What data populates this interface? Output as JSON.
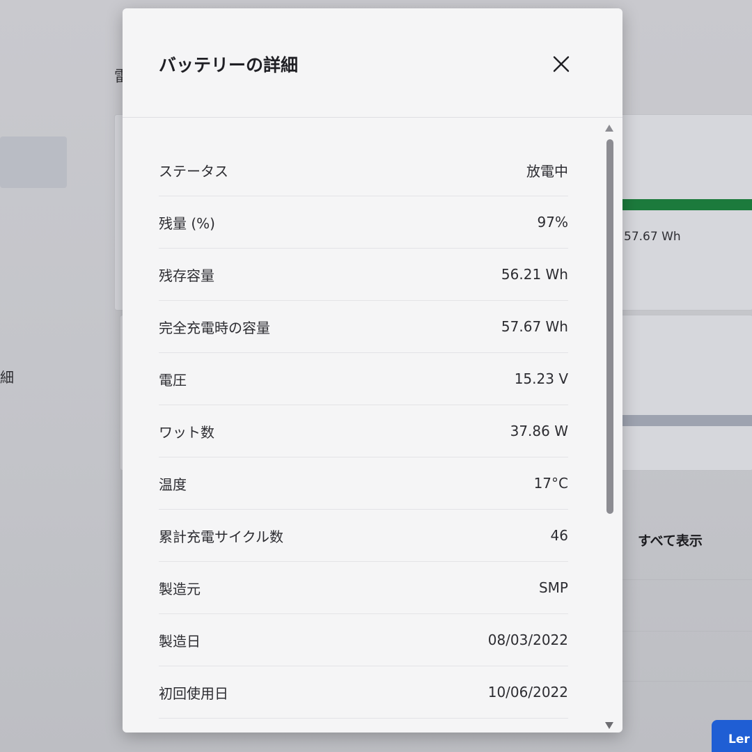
{
  "background": {
    "title_fragment": "雷",
    "side_label_fragment": "細",
    "full_charge_value": "57.67 Wh",
    "show_all_link": "すべて表示",
    "brand_button": "Ler",
    "accent_green": "#1c7a3c",
    "accent_blue": "#1f5ed4"
  },
  "dialog": {
    "title": "バッテリーの詳細",
    "close_icon": "close-icon",
    "rows": [
      {
        "label": "ステータス",
        "value": "放電中"
      },
      {
        "label": "残量 (%)",
        "value": "97%"
      },
      {
        "label": "残存容量",
        "value": "56.21 Wh"
      },
      {
        "label": "完全充電時の容量",
        "value": "57.67 Wh"
      },
      {
        "label": "電圧",
        "value": "15.23 V"
      },
      {
        "label": "ワット数",
        "value": "37.86 W"
      },
      {
        "label": "温度",
        "value": "17°C"
      },
      {
        "label": "累計充電サイクル数",
        "value": "46"
      },
      {
        "label": "製造元",
        "value": "SMP"
      },
      {
        "label": "製造日",
        "value": "08/03/2022"
      },
      {
        "label": "初回使用日",
        "value": "10/06/2022"
      }
    ]
  }
}
